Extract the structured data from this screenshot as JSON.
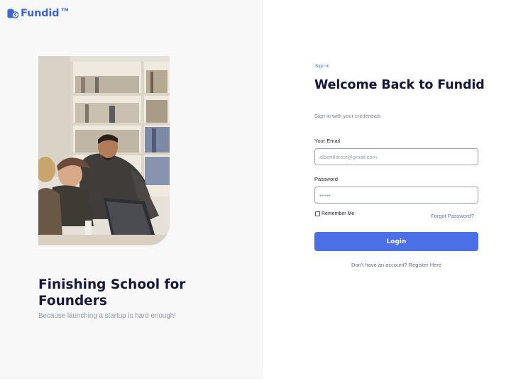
{
  "brand": {
    "name": "Fundid",
    "trademark": "TM",
    "color": "#3e66d6"
  },
  "hero": {
    "title": "Finishing School for Founders",
    "subtitle": "Because launching a startup is hard enough!"
  },
  "signin": {
    "crumb": "Sign In",
    "title": "Welcome Back to Fundid",
    "subtitle": "Sign in with your credentials.",
    "email_label": "Your Email",
    "email_placeholder": "albertflorest@gmail.com",
    "password_label": "Password",
    "password_placeholder": "••••••",
    "remember_label": "Remember Me",
    "forgot_label": "Forgot Password?",
    "login_label": "Login",
    "register_text": "Don't have an account? Register Here"
  },
  "colors": {
    "accent": "#4b6fe6",
    "heading": "#13183a",
    "left_panel_bg": "#f8f8f8"
  }
}
